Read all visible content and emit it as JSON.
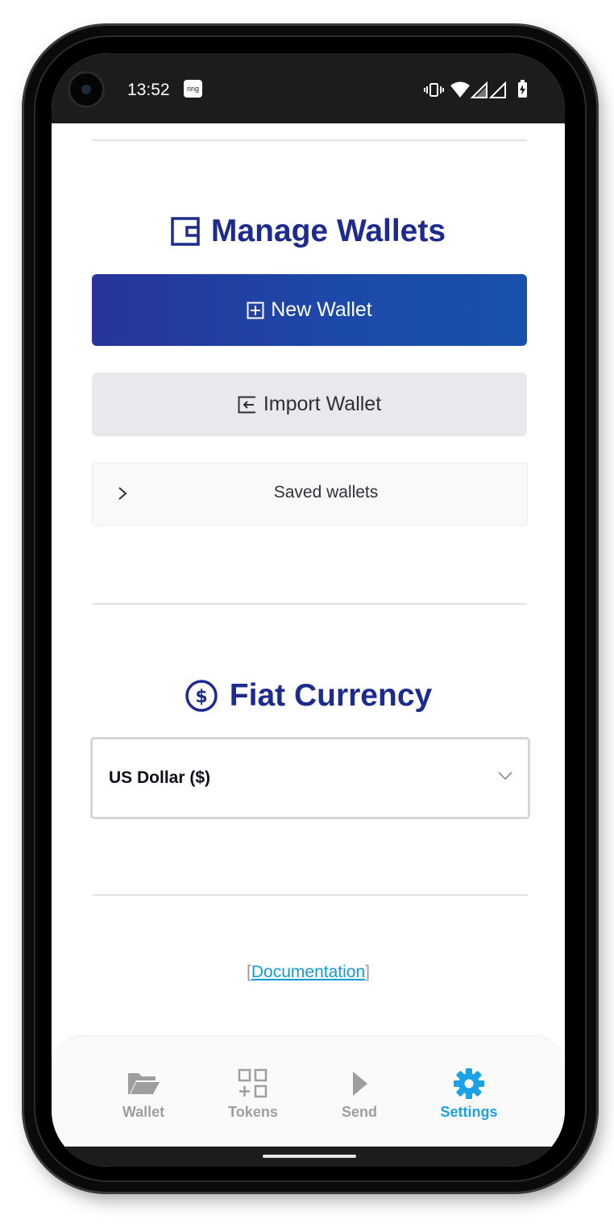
{
  "status_bar": {
    "time": "13:52",
    "notification_badge": "ring",
    "icons": [
      "vibrate-icon",
      "wifi-icon",
      "signal-icon",
      "signal-icon",
      "battery-charging-icon"
    ]
  },
  "manage_wallets": {
    "title": "Manage Wallets",
    "title_icon": "wallet-icon",
    "new_wallet_label": "New Wallet",
    "new_wallet_icon": "plus-square-icon",
    "import_wallet_label": "Import Wallet",
    "import_wallet_icon": "import-icon",
    "saved_wallets_label": "Saved wallets"
  },
  "fiat_currency": {
    "title": "Fiat Currency",
    "title_icon": "dollar-circle-icon",
    "selected_value": "US Dollar ($)"
  },
  "documentation": {
    "open_bracket": "[",
    "link_label": "Documentation",
    "close_bracket": "]"
  },
  "tabbar": {
    "active_tab": "Settings",
    "tabs": [
      {
        "label": "Wallet",
        "icon": "folder-icon"
      },
      {
        "label": "Tokens",
        "icon": "grid-plus-icon"
      },
      {
        "label": "Send",
        "icon": "play-icon"
      },
      {
        "label": "Settings",
        "icon": "gear-icon"
      }
    ]
  },
  "colors": {
    "brand_dark": "#1e2b8e",
    "button_gradient_start": "#27349a",
    "button_gradient_end": "#1851ad",
    "active_tab": "#1ba2e6",
    "link": "#159ad8",
    "inactive_tab": "#9e9e9e"
  }
}
